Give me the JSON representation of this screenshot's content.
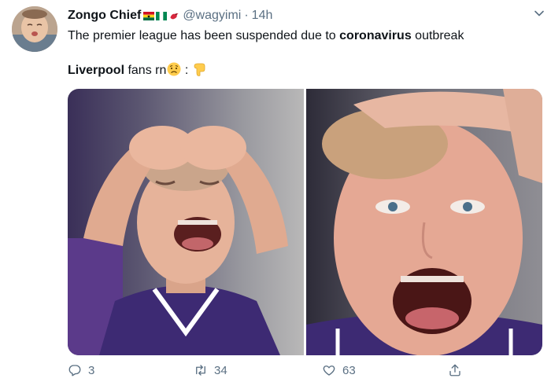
{
  "tweet": {
    "author_name": "Zongo Chief",
    "author_handle": "@wagyimi",
    "separator": "·",
    "timestamp": "14h",
    "line1_prefix": "The premier league has been suspended due to ",
    "line1_bold": "coronavirus",
    "line1_suffix": " outbreak",
    "line2_bold": "Liverpool",
    "line2_text": " fans rn",
    "line2_after_emoji": " : ",
    "flag_icons": [
      "ghana-flag-icon",
      "nigeria-flag-icon",
      "red-bird-icon"
    ],
    "emoji_icons": [
      "worried-face-emoji",
      "pointing-down-emoji"
    ]
  },
  "media": {
    "images": [
      {
        "name": "crying-boy-left-image"
      },
      {
        "name": "crying-boy-right-image"
      }
    ]
  },
  "actions": {
    "reply_count": "3",
    "retweet_count": "34",
    "like_count": "63"
  },
  "colors": {
    "text": "#0f1419",
    "muted": "#5b7083",
    "jersey_purple": "#3d2a73"
  }
}
